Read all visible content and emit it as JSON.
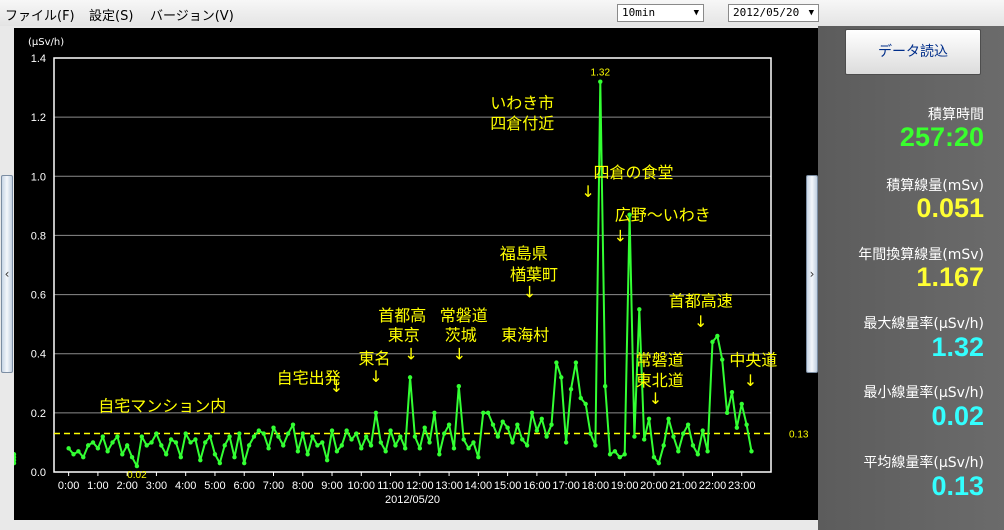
{
  "menu": {
    "file": "ファイル(F)",
    "settings": "設定(S)",
    "version": "バージョン(V)"
  },
  "controls": {
    "interval": "10min",
    "date": "2012/05/20",
    "load_button": "データ読込",
    "left_arrow": "‹",
    "right_arrow": "›"
  },
  "stats": [
    {
      "label": "積算時間",
      "value": "257:20",
      "color": "#39ff2e"
    },
    {
      "label": "積算線量(mSv)",
      "value": "0.051",
      "color": "#ffff33"
    },
    {
      "label": "年間換算線量(mSv)",
      "value": "1.167",
      "color": "#ffff33"
    },
    {
      "label": "最大線量率(μSv/h)",
      "value": "1.32",
      "color": "#33ffff"
    },
    {
      "label": "最小線量率(μSv/h)",
      "value": "0.02",
      "color": "#33ffff"
    },
    {
      "label": "平均線量率(μSv/h)",
      "value": "0.13",
      "color": "#33ffff"
    }
  ],
  "chart_data": {
    "type": "line",
    "ylabel": "(μSv/h)",
    "xlabel": "2012/05/20",
    "ylim": [
      0,
      1.4
    ],
    "xlim": [
      -0.5,
      24
    ],
    "yticks": [
      "0.0",
      "0.2",
      "0.4",
      "0.6",
      "0.8",
      "1.0",
      "1.2",
      "1.4"
    ],
    "xticks": [
      "0:00",
      "1:00",
      "2:00",
      "3:00",
      "4:00",
      "5:00",
      "6:00",
      "7:00",
      "8:00",
      "9:00",
      "10:00",
      "11:00",
      "12:00",
      "13:00",
      "14:00",
      "15:00",
      "16:00",
      "17:00",
      "18:00",
      "19:00",
      "20:00",
      "21:00",
      "22:00",
      "23:00"
    ],
    "grid": true,
    "line_color": "#33ff33",
    "average_line": {
      "value": 0.13,
      "label": "0.13",
      "color": "#ffff00"
    },
    "max_label": "1.32",
    "min_label": "0.02",
    "x": [
      0,
      0.167,
      0.333,
      0.5,
      0.667,
      0.833,
      1,
      1.167,
      1.333,
      1.5,
      1.667,
      1.833,
      2,
      2.167,
      2.333,
      2.5,
      2.667,
      2.833,
      3,
      3.167,
      3.333,
      3.5,
      3.667,
      3.833,
      4,
      4.167,
      4.333,
      4.5,
      4.667,
      4.833,
      5,
      5.167,
      5.333,
      5.5,
      5.667,
      5.833,
      6,
      6.167,
      6.333,
      6.5,
      6.667,
      6.833,
      7,
      7.167,
      7.333,
      7.5,
      7.667,
      7.833,
      8,
      8.167,
      8.333,
      8.5,
      8.667,
      8.833,
      9,
      9.167,
      9.333,
      9.5,
      9.667,
      9.833,
      10,
      10.167,
      10.333,
      10.5,
      10.667,
      10.833,
      11,
      11.167,
      11.333,
      11.5,
      11.667,
      11.833,
      12,
      12.167,
      12.333,
      12.5,
      12.667,
      12.833,
      13,
      13.167,
      13.333,
      13.5,
      13.667,
      13.833,
      14,
      14.167,
      14.333,
      14.5,
      14.667,
      14.833,
      15,
      15.167,
      15.333,
      15.5,
      15.667,
      15.833,
      16,
      16.167,
      16.333,
      16.5,
      16.667,
      16.833,
      17,
      17.167,
      17.333,
      17.5,
      17.667,
      17.833,
      18,
      18.167,
      18.333,
      18.5,
      18.667,
      18.833,
      19,
      19.167,
      19.333,
      19.5,
      19.667,
      19.833,
      20,
      20.167,
      20.333,
      20.5,
      20.667,
      20.833,
      21,
      21.167,
      21.333,
      21.5,
      21.667,
      21.833,
      22,
      22.167,
      22.333,
      22.5,
      22.667,
      22.833,
      23,
      23.167,
      23.333
    ],
    "y": [
      0.08,
      0.06,
      0.07,
      0.05,
      0.09,
      0.1,
      0.08,
      0.12,
      0.07,
      0.1,
      0.12,
      0.06,
      0.09,
      0.05,
      0.02,
      0.12,
      0.09,
      0.1,
      0.13,
      0.09,
      0.06,
      0.11,
      0.1,
      0.05,
      0.13,
      0.1,
      0.11,
      0.04,
      0.1,
      0.12,
      0.06,
      0.03,
      0.09,
      0.12,
      0.05,
      0.13,
      0.03,
      0.09,
      0.12,
      0.14,
      0.13,
      0.08,
      0.15,
      0.12,
      0.09,
      0.13,
      0.16,
      0.07,
      0.13,
      0.06,
      0.12,
      0.09,
      0.1,
      0.04,
      0.14,
      0.07,
      0.09,
      0.14,
      0.11,
      0.13,
      0.08,
      0.12,
      0.09,
      0.2,
      0.1,
      0.07,
      0.14,
      0.09,
      0.12,
      0.08,
      0.32,
      0.12,
      0.08,
      0.15,
      0.1,
      0.2,
      0.06,
      0.13,
      0.16,
      0.08,
      0.29,
      0.11,
      0.08,
      0.1,
      0.05,
      0.2,
      0.2,
      0.16,
      0.12,
      0.17,
      0.15,
      0.1,
      0.16,
      0.11,
      0.09,
      0.2,
      0.14,
      0.18,
      0.12,
      0.16,
      0.37,
      0.32,
      0.1,
      0.28,
      0.37,
      0.25,
      0.23,
      0.13,
      0.09,
      1.32,
      0.29,
      0.06,
      0.07,
      0.05,
      0.06,
      0.87,
      0.12,
      0.55,
      0.11,
      0.18,
      0.05,
      0.03,
      0.09,
      0.18,
      0.12,
      0.07,
      0.13,
      0.16,
      0.09,
      0.06,
      0.14,
      0.07,
      0.44,
      0.46,
      0.38,
      0.2,
      0.27,
      0.15,
      0.23,
      0.16,
      0.07,
      0.04,
      0.03,
      0.05,
      0.06
    ],
    "annotations": [
      {
        "text": "自宅マンション内",
        "x": 3.2,
        "y": 0.205
      },
      {
        "text": "↓",
        "x": 9.15,
        "y": 0.27
      },
      {
        "text": "自宅出発",
        "x": 8.2,
        "y": 0.3
      },
      {
        "text": "東名",
        "x": 10.45,
        "y": 0.365
      },
      {
        "text": "↓",
        "x": 10.5,
        "y": 0.305
      },
      {
        "text": "首都高",
        "x": 11.4,
        "y": 0.51
      },
      {
        "text": "東京",
        "x": 11.45,
        "y": 0.445
      },
      {
        "text": "↓",
        "x": 11.7,
        "y": 0.38
      },
      {
        "text": "常磐道",
        "x": 13.5,
        "y": 0.51
      },
      {
        "text": "茨城",
        "x": 13.4,
        "y": 0.445
      },
      {
        "text": "↓",
        "x": 13.35,
        "y": 0.38
      },
      {
        "text": "東海村",
        "x": 15.6,
        "y": 0.445
      },
      {
        "text": "福島県",
        "x": 15.55,
        "y": 0.72
      },
      {
        "text": "楢葉町",
        "x": 15.9,
        "y": 0.65
      },
      {
        "text": "↓",
        "x": 15.75,
        "y": 0.59
      },
      {
        "text": "いわき市",
        "x": 15.5,
        "y": 1.23
      },
      {
        "text": "四倉付近",
        "x": 15.5,
        "y": 1.16
      },
      {
        "text": "四倉の食堂",
        "x": 19.3,
        "y": 0.995
      },
      {
        "text": "↓",
        "x": 17.75,
        "y": 0.93
      },
      {
        "text": "広野～いわき",
        "x": 20.3,
        "y": 0.85
      },
      {
        "text": "↓",
        "x": 18.85,
        "y": 0.78
      },
      {
        "text": "首都高速",
        "x": 21.6,
        "y": 0.56
      },
      {
        "text": "↓",
        "x": 21.6,
        "y": 0.49
      },
      {
        "text": "常磐道",
        "x": 20.2,
        "y": 0.36
      },
      {
        "text": "東北道",
        "x": 20.2,
        "y": 0.29
      },
      {
        "text": "↓",
        "x": 20.05,
        "y": 0.23
      },
      {
        "text": "中央道",
        "x": 23.4,
        "y": 0.36
      },
      {
        "text": "↓",
        "x": 23.3,
        "y": 0.29
      }
    ]
  }
}
